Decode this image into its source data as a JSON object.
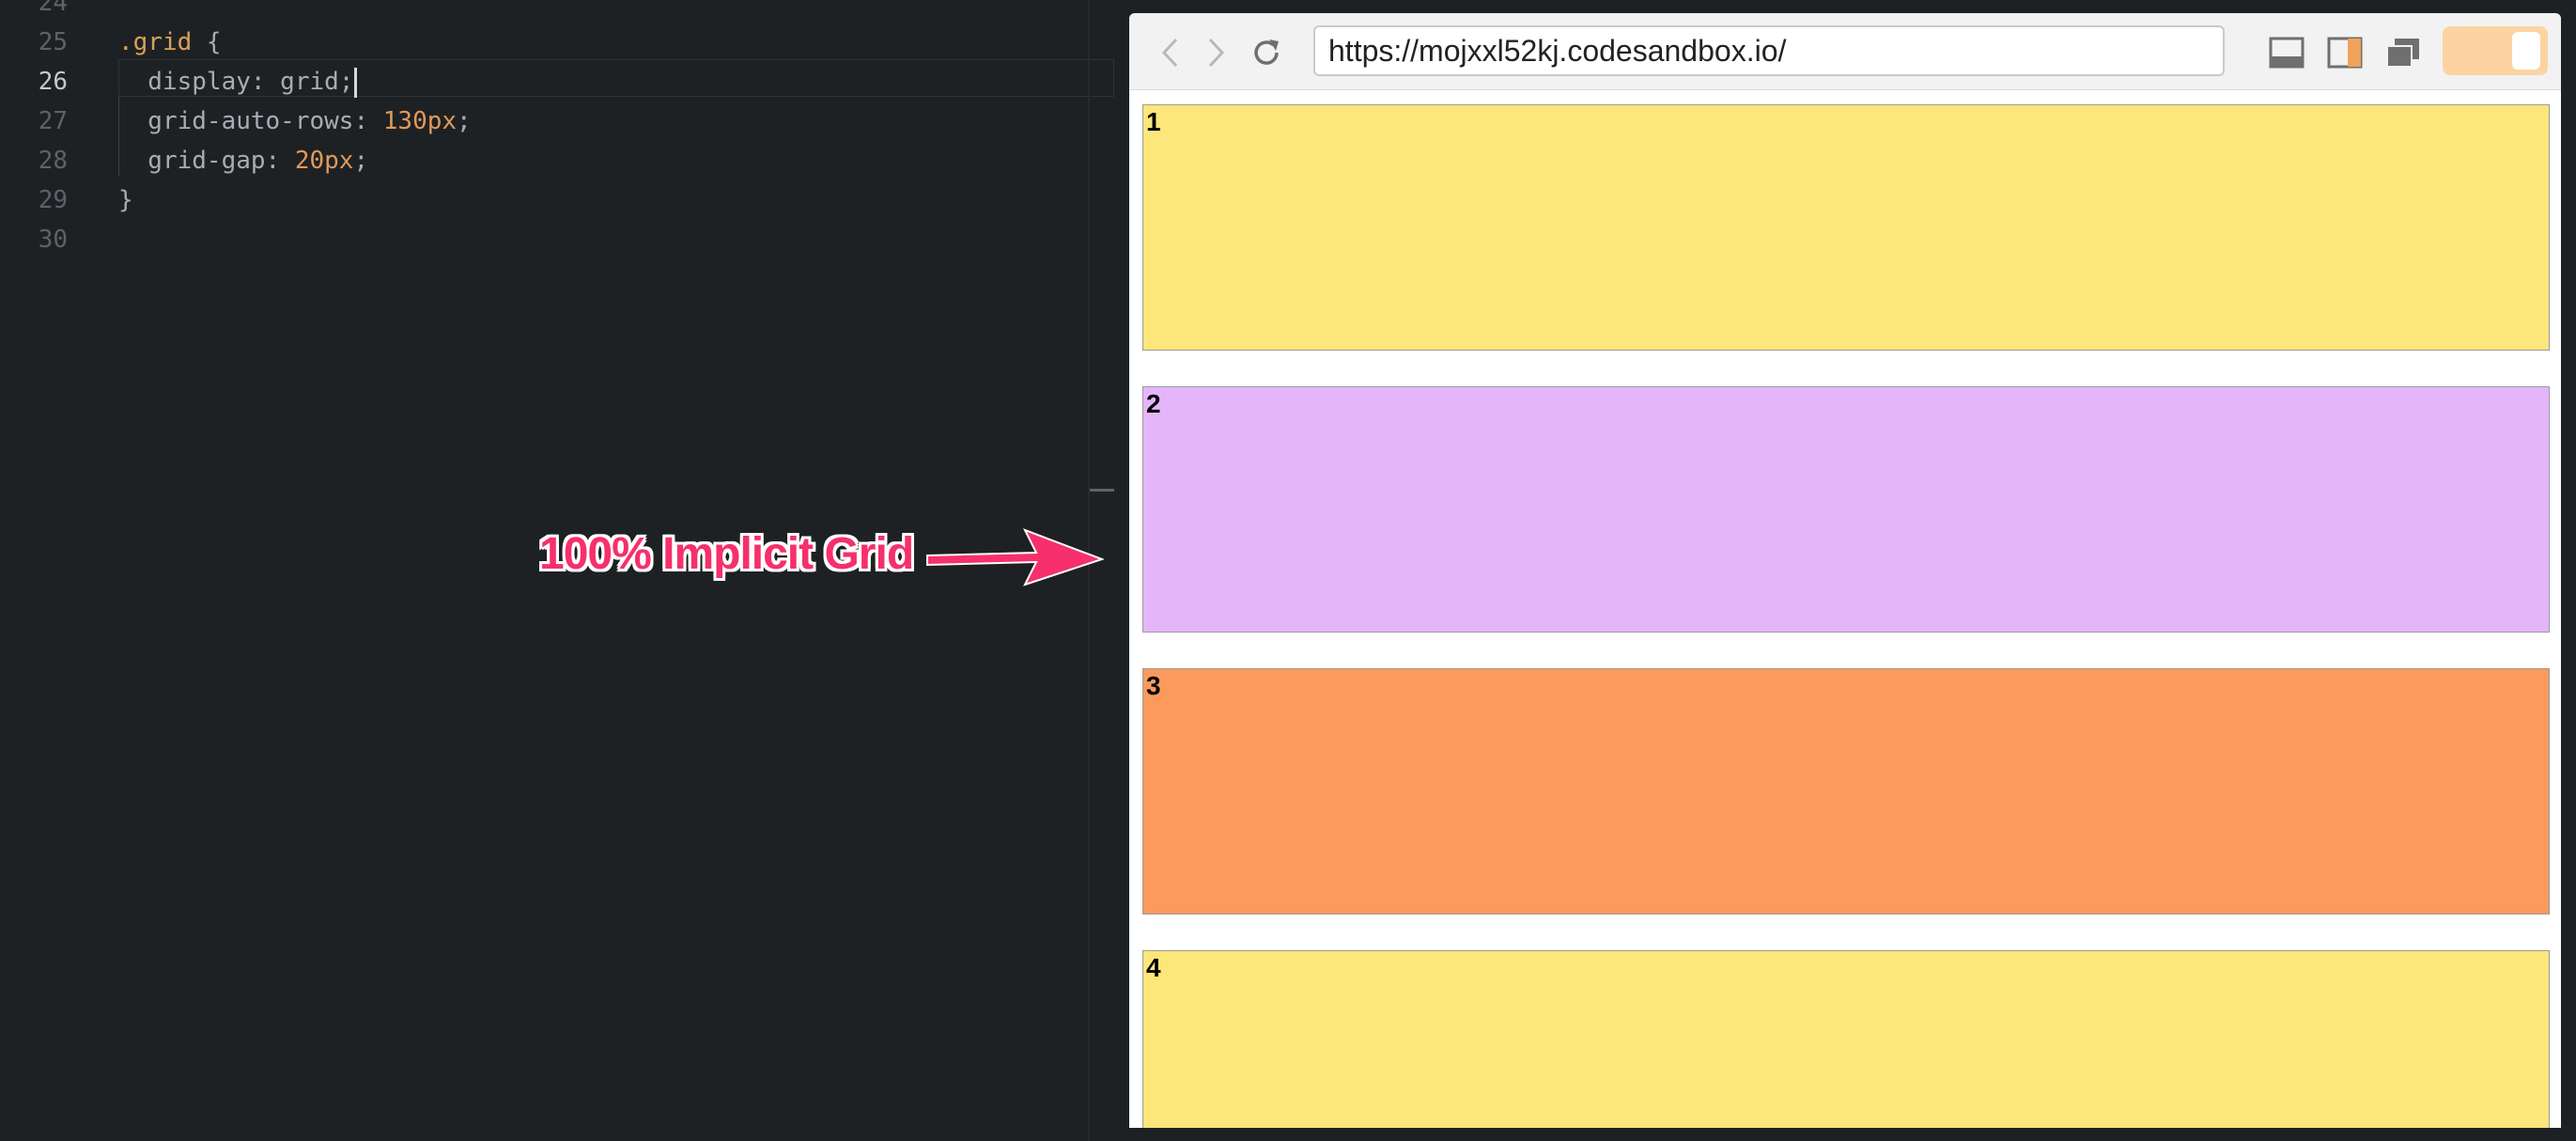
{
  "editor": {
    "lines": [
      {
        "num": "24",
        "parts": []
      },
      {
        "num": "25",
        "parts": [
          {
            "t": ".grid",
            "c": "sel"
          },
          {
            "t": " {",
            "c": ""
          }
        ]
      },
      {
        "num": "26",
        "parts": [
          {
            "t": "  display: grid;",
            "c": ""
          }
        ],
        "current": true
      },
      {
        "num": "27",
        "parts": [
          {
            "t": "  grid-auto-rows: ",
            "c": ""
          },
          {
            "t": "130px",
            "c": "num"
          },
          {
            "t": ";",
            "c": ""
          }
        ]
      },
      {
        "num": "28",
        "parts": [
          {
            "t": "  grid-gap: ",
            "c": ""
          },
          {
            "t": "20px",
            "c": "num"
          },
          {
            "t": ";",
            "c": ""
          }
        ]
      },
      {
        "num": "29",
        "parts": [
          {
            "t": "}",
            "c": ""
          }
        ]
      },
      {
        "num": "30",
        "parts": []
      }
    ]
  },
  "annotation": {
    "label": "100% Implicit Grid",
    "color": "#f5306c"
  },
  "browser": {
    "url": "https://mojxxl52kj.codesandbox.io/",
    "icons": {
      "back": "chevron-left-icon",
      "forward": "chevron-right-icon",
      "reload": "reload-icon",
      "dock_bottom": "dock-bottom-icon",
      "dock_side": "dock-side-icon",
      "new_window": "new-window-icon"
    },
    "grid_items": [
      {
        "label": "1",
        "color": "#fde67a"
      },
      {
        "label": "2",
        "color": "#e5b5fb"
      },
      {
        "label": "3",
        "color": "#fb9a5c"
      },
      {
        "label": "4",
        "color": "#fde67a"
      }
    ]
  }
}
